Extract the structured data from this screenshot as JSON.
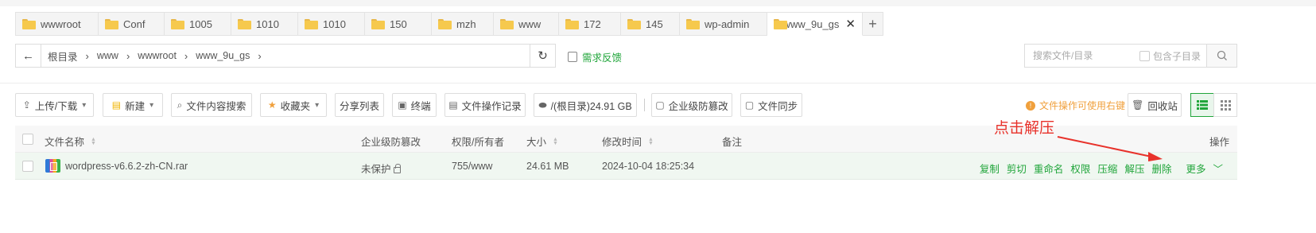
{
  "tabs": [
    {
      "label": "wwwroot",
      "width": 104
    },
    {
      "label": "Conf",
      "width": 83
    },
    {
      "label": "1005",
      "width": 84
    },
    {
      "label": "1010",
      "width": 84
    },
    {
      "label": "1010",
      "width": 84
    },
    {
      "label": "150",
      "width": 84
    },
    {
      "label": "mzh",
      "width": 78
    },
    {
      "label": "www",
      "width": 82
    },
    {
      "label": "172",
      "width": 78
    },
    {
      "label": "145",
      "width": 74
    },
    {
      "label": "wp-admin",
      "width": 110
    },
    {
      "label": "www_9u_gs",
      "active": true
    }
  ],
  "path": {
    "crumbs": [
      "根目录",
      "www",
      "wwwroot",
      "www_9u_gs"
    ],
    "feedback": "需求反馈"
  },
  "search": {
    "placeholder": "搜索文件/目录",
    "subdir_label": "包含子目录"
  },
  "toolbar": {
    "upload": "上传/下载",
    "new": "新建",
    "content_search": "文件内容搜索",
    "favorites": "收藏夹",
    "share_list": "分享列表",
    "terminal": "终端",
    "op_log": "文件操作记录",
    "disk": "/(根目录)24.91 GB",
    "tamper": "企业级防篡改",
    "sync": "文件同步",
    "tip": "文件操作可使用右键",
    "recycle": "回收站"
  },
  "table": {
    "headers": {
      "name": "文件名称",
      "tamper": "企业级防篡改",
      "perm": "权限/所有者",
      "size": "大小",
      "mtime": "修改时间",
      "note": "备注",
      "ops": "操作"
    },
    "rows": [
      {
        "name": "wordpress-v6.6.2-zh-CN.rar",
        "tamper": "未保护",
        "perm": "755/www",
        "size": "24.61 MB",
        "mtime": "2024-10-04 18:25:34",
        "note": "",
        "actions": [
          "复制",
          "剪切",
          "重命名",
          "权限",
          "压缩",
          "解压",
          "删除",
          "更多"
        ]
      }
    ]
  },
  "annotation": {
    "text": "点击解压",
    "color": "#e8322b"
  },
  "colors": {
    "accent": "#20a53a",
    "warning": "#f0a03c"
  }
}
